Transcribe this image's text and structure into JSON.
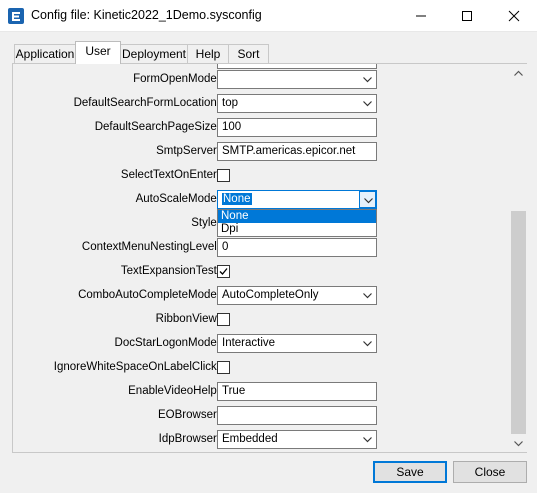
{
  "window": {
    "title": "Config file: Kinetic2022_1Demo.sysconfig",
    "icon": "epicor-e-icon",
    "controls": [
      "minimize-icon",
      "maximize-icon",
      "close-icon"
    ]
  },
  "tabs": [
    {
      "label": "Application",
      "active": false
    },
    {
      "label": "User",
      "active": true
    },
    {
      "label": "Deployment",
      "active": false
    },
    {
      "label": "Help",
      "active": false
    },
    {
      "label": "Sort",
      "active": false
    }
  ],
  "settings": {
    "form_open_mode": {
      "label": "FormOpenMode:",
      "value": ""
    },
    "default_search_form_location": {
      "label": "DefaultSearchFormLocation:",
      "value": "top"
    },
    "default_search_page_size": {
      "label": "DefaultSearchPageSize:",
      "value": "100"
    },
    "smtp_server": {
      "label": "SmtpServer:",
      "value": "SMTP.americas.epicor.net"
    },
    "select_text_on_enter": {
      "label": "SelectTextOnEnter:",
      "checked": false
    },
    "auto_scale_mode": {
      "label": "AutoScaleMode:",
      "value": "None",
      "options": [
        "None",
        "Dpi"
      ],
      "highlighted_option": "None"
    },
    "style": {
      "label": "Style:"
    },
    "context_menu_nesting_level": {
      "label": "ContextMenuNestingLevel:",
      "value": "0"
    },
    "text_expansion_test": {
      "label": "TextExpansionTest:",
      "checked": true
    },
    "combo_auto_complete_mode": {
      "label": "ComboAutoCompleteMode:",
      "value": "AutoCompleteOnly"
    },
    "ribbon_view": {
      "label": "RibbonView:",
      "checked": false
    },
    "doc_star_logon_mode": {
      "label": "DocStarLogonMode:",
      "value": "Interactive"
    },
    "ignore_white_space_on_label_click": {
      "label": "IgnoreWhiteSpaceOnLabelClick:",
      "checked": false
    },
    "enable_video_help": {
      "label": "EnableVideoHelp:",
      "value": "True"
    },
    "eo_browser": {
      "label": "EOBrowser:",
      "value": ""
    },
    "idp_browser": {
      "label": "IdpBrowser:",
      "value": "Embedded"
    }
  },
  "buttons": {
    "save": "Save",
    "close": "Close"
  },
  "colors": {
    "accent": "#0078d7",
    "titlebar": "#ffffff",
    "background": "#f0f0f0"
  }
}
